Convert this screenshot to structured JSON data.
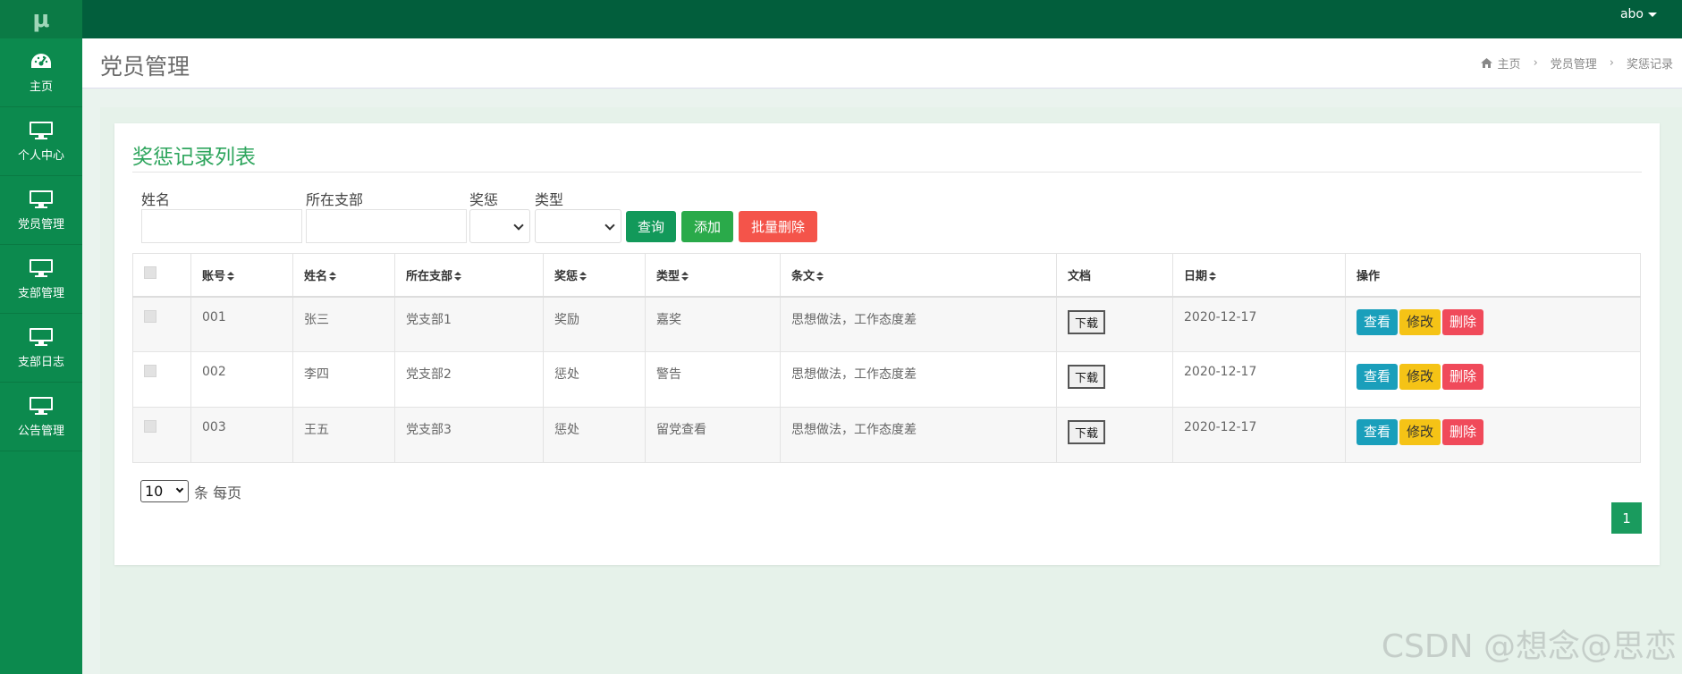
{
  "app": {
    "logo": "μ",
    "user": "abo"
  },
  "sidebar": {
    "items": [
      {
        "label": "主页",
        "icon": "dashboard-icon"
      },
      {
        "label": "个人中心",
        "icon": "monitor-icon"
      },
      {
        "label": "党员管理",
        "icon": "monitor-icon"
      },
      {
        "label": "支部管理",
        "icon": "monitor-icon"
      },
      {
        "label": "支部日志",
        "icon": "monitor-icon"
      },
      {
        "label": "公告管理",
        "icon": "monitor-icon"
      }
    ]
  },
  "header": {
    "title": "党员管理",
    "breadcrumb": [
      "主页",
      "党员管理",
      "奖惩记录"
    ]
  },
  "card": {
    "title": "奖惩记录列表"
  },
  "filters": {
    "name_label": "姓名",
    "branch_label": "所在支部",
    "reward_label": "奖惩",
    "type_label": "类型",
    "name_value": "",
    "branch_value": "",
    "reward_value": "",
    "type_value": "",
    "query_btn": "查询",
    "add_btn": "添加",
    "batch_delete_btn": "批量删除"
  },
  "table": {
    "headers": [
      "账号",
      "姓名",
      "所在支部",
      "奖惩",
      "类型",
      "条文",
      "文档",
      "日期",
      "操作"
    ],
    "rows": [
      {
        "account": "001",
        "name": "张三",
        "branch": "党支部1",
        "reward": "奖励",
        "type": "嘉奖",
        "clause": "思想做法，工作态度差",
        "doc": "下载",
        "date": "2020-12-17"
      },
      {
        "account": "002",
        "name": "李四",
        "branch": "党支部2",
        "reward": "惩处",
        "type": "警告",
        "clause": "思想做法，工作态度差",
        "doc": "下载",
        "date": "2020-12-17"
      },
      {
        "account": "003",
        "name": "王五",
        "branch": "党支部3",
        "reward": "惩处",
        "type": "留党查看",
        "clause": "思想做法，工作态度差",
        "doc": "下载",
        "date": "2020-12-17"
      }
    ],
    "actions": {
      "view": "查看",
      "edit": "修改",
      "delete": "删除"
    }
  },
  "pagination": {
    "page_size": "10",
    "page_size_suffix": "条 每页",
    "current_page": "1"
  },
  "watermark": "CSDN @想念@思恋",
  "colors": {
    "sidebar": "#0c8a4e",
    "topbar": "#025e3c",
    "accent": "#2ea55d",
    "view": "#1a9fbb",
    "edit": "#f5c316",
    "delete": "#f04a5a"
  }
}
